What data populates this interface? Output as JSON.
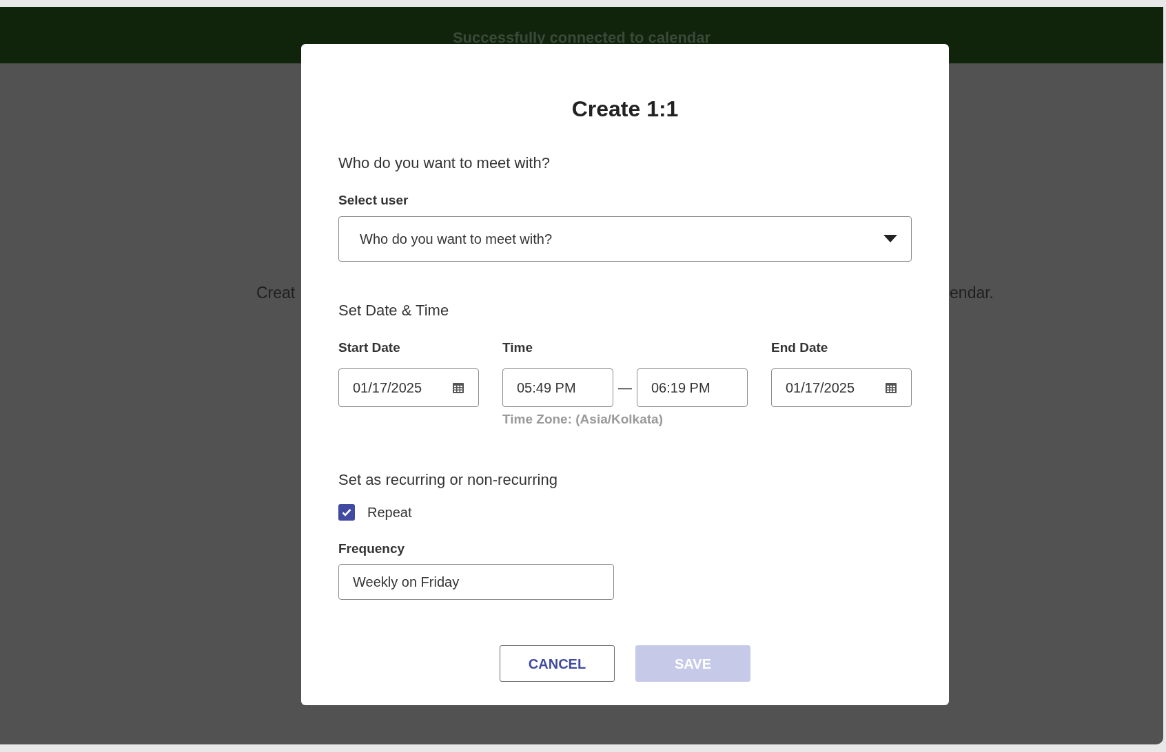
{
  "banner": {
    "message": "Successfully connected to calendar"
  },
  "background": {
    "text_left": "Creat",
    "text_right": "endar."
  },
  "dialog": {
    "title": "Create 1:1",
    "user_section": {
      "heading": "Who do you want to meet with?",
      "label": "Select user",
      "placeholder": "Who do you want to meet with?"
    },
    "datetime_section": {
      "heading": "Set Date & Time",
      "start_date": {
        "label": "Start Date",
        "value": "01/17/2025"
      },
      "time": {
        "label": "Time",
        "start": "05:49 PM",
        "separator": "—",
        "end": "06:19 PM",
        "timezone": "Time Zone: (Asia/Kolkata)"
      },
      "end_date": {
        "label": "End Date",
        "value": "01/17/2025"
      }
    },
    "recurrence_section": {
      "heading": "Set as recurring or non-recurring",
      "repeat": {
        "label": "Repeat",
        "checked": true
      },
      "frequency": {
        "label": "Frequency",
        "value": "Weekly on Friday"
      }
    },
    "buttons": [
      {
        "label": "CANCEL",
        "kind": "secondary",
        "disabled": false
      },
      {
        "label": "SAVE",
        "kind": "primary",
        "disabled": true
      }
    ]
  }
}
